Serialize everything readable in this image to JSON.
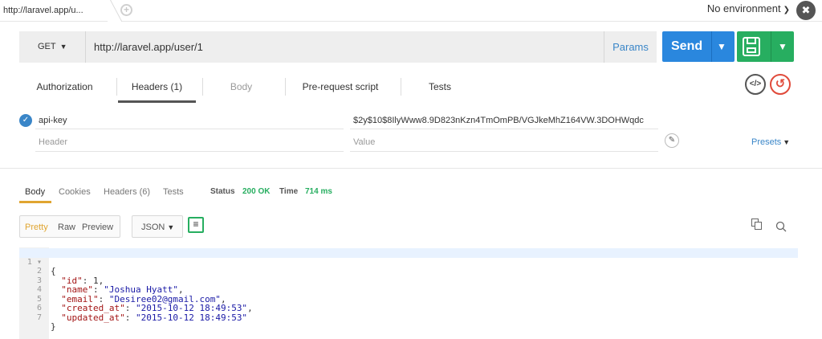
{
  "tabbar": {
    "active_tab": "http://laravel.app/u...",
    "environment": "No environment"
  },
  "request": {
    "method": "GET",
    "url": "http://laravel.app/user/1",
    "params_label": "Params",
    "send_label": "Send"
  },
  "request_tabs": [
    {
      "label": "Authorization",
      "state": "normal"
    },
    {
      "label": "Headers (1)",
      "state": "active"
    },
    {
      "label": "Body",
      "state": "disabled"
    },
    {
      "label": "Pre-request script",
      "state": "normal"
    },
    {
      "label": "Tests",
      "state": "normal"
    }
  ],
  "headers": {
    "rows": [
      {
        "key": "api-key",
        "value": "$2y$10$8IlyWww8.9D823nKzn4TmOmPB/VGJkeMhZ164VW.3DOHWqdc",
        "enabled": true
      }
    ],
    "key_placeholder": "Header",
    "value_placeholder": "Value",
    "presets_label": "Presets"
  },
  "response": {
    "tabs": [
      "Body",
      "Cookies",
      "Headers (6)",
      "Tests"
    ],
    "status_label": "Status",
    "status_value": "200 OK",
    "time_label": "Time",
    "time_value": "714 ms",
    "formats": [
      "Pretty",
      "Raw",
      "Preview"
    ],
    "language": "JSON",
    "code_lines": [
      {
        "num": "1",
        "fold": "▾",
        "text": "{"
      },
      {
        "num": "2",
        "key": "\"id\"",
        "value": "1",
        "type": "n",
        "comma": ","
      },
      {
        "num": "3",
        "key": "\"name\"",
        "value": "\"Joshua Hyatt\"",
        "type": "s",
        "comma": ","
      },
      {
        "num": "4",
        "key": "\"email\"",
        "value": "\"Desiree02@gmail.com\"",
        "type": "s",
        "comma": ","
      },
      {
        "num": "5",
        "key": "\"created_at\"",
        "value": "\"2015-10-12 18:49:53\"",
        "type": "s",
        "comma": ","
      },
      {
        "num": "6",
        "key": "\"updated_at\"",
        "value": "\"2015-10-12 18:49:53\"",
        "type": "s",
        "comma": ""
      },
      {
        "num": "7",
        "text": "}"
      }
    ]
  },
  "colors": {
    "send": "#2a87de",
    "save": "#27ae60",
    "accent": "#e0a531",
    "status_ok": "#27ae60",
    "link": "#3a86c8"
  }
}
